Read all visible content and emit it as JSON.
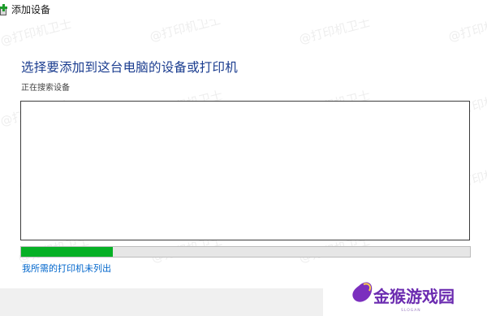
{
  "window": {
    "title": "添加设备"
  },
  "main": {
    "heading": "选择要添加到这台电脑的设备或打印机",
    "status": "正在搜索设备",
    "progress_fraction": 0.205,
    "progress_color": "#06b025",
    "link_text": "我所需的打印机未列出"
  },
  "watermark_text": "@打印机卫士",
  "logo": {
    "text": "金猴游戏园",
    "slogan": "SLOGAN"
  },
  "colors": {
    "heading": "#1a3c8f",
    "link": "#0066cc"
  }
}
